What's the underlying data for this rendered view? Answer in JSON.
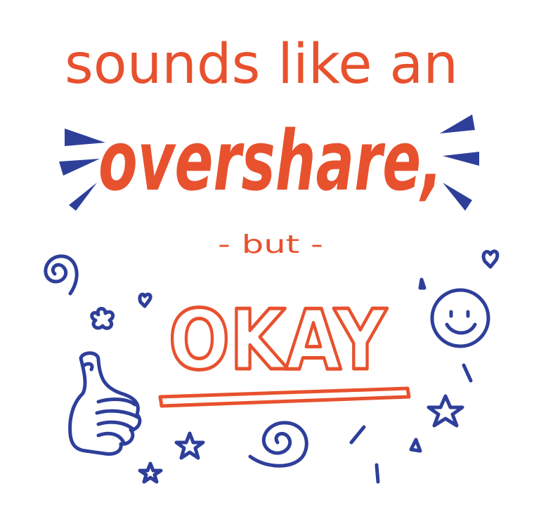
{
  "lettering": {
    "line1": "sounds like an",
    "line2": "overshare,",
    "line3": "- but -",
    "line4": "OKAY"
  },
  "colors": {
    "text_red": "#e8512e",
    "doodle_blue": "#2e3f9a",
    "background": "#ffffff"
  },
  "doodles": [
    "thumbs-up-icon",
    "smiley-face-icon",
    "spiral-icon",
    "star-icon",
    "heart-icon",
    "flower-icon",
    "burst-mark-icon"
  ]
}
